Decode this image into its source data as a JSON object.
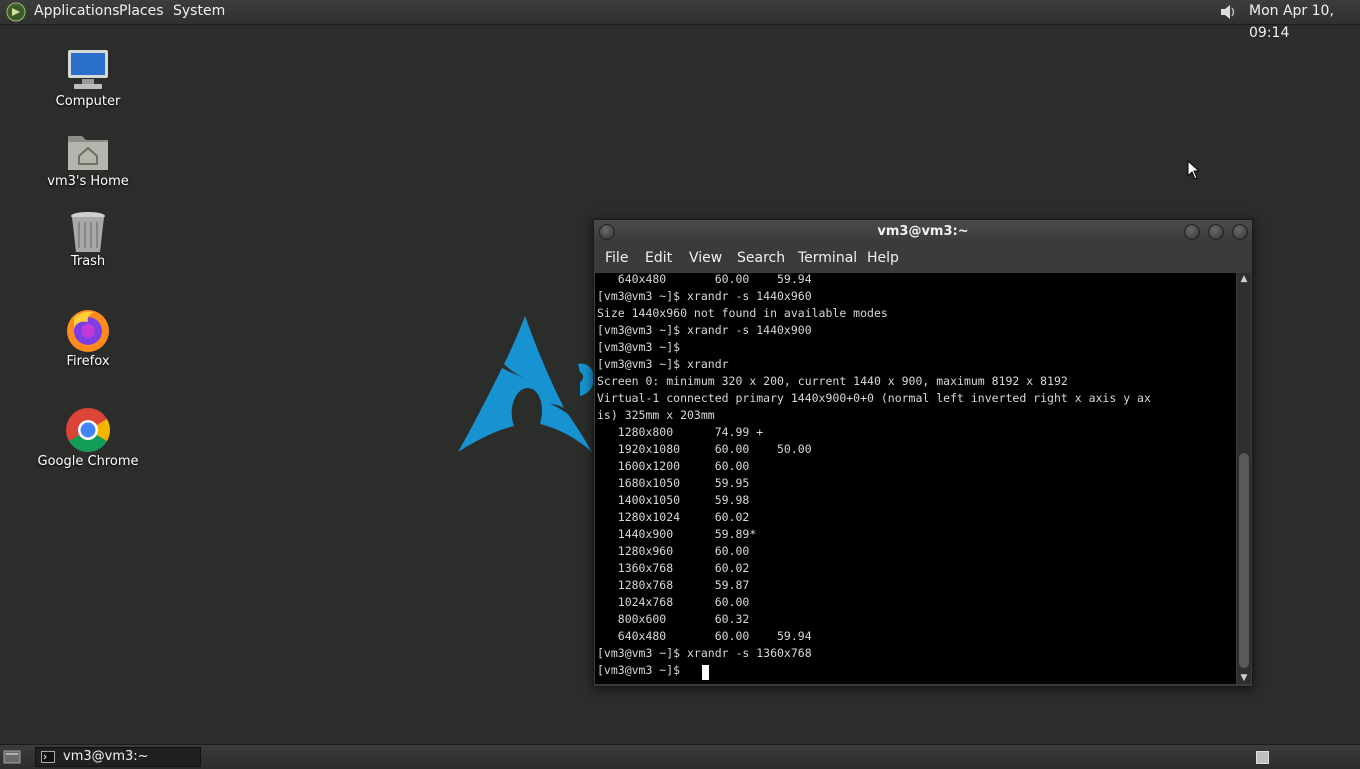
{
  "top_panel": {
    "menus": [
      "Applications",
      "Places",
      "System"
    ],
    "clock": "Mon Apr 10, 09:14",
    "logo_icon": "gnome-foot-icon",
    "tray_icons": [
      "speaker-icon"
    ]
  },
  "desktop": {
    "icons": [
      {
        "label": "Computer",
        "icon": "computer-icon"
      },
      {
        "label": "vm3's Home",
        "icon": "home-folder-icon"
      },
      {
        "label": "Trash",
        "icon": "trash-icon"
      },
      {
        "label": "Firefox",
        "icon": "firefox-icon"
      },
      {
        "label": "Google Chrome",
        "icon": "chrome-icon"
      }
    ],
    "wallpaper_logo": "arch-linux-logo",
    "colors": {
      "background": "#2b2d2b",
      "arch_blue": "#1793d1"
    }
  },
  "terminal": {
    "title": "vm3@vm3:~",
    "menu": [
      "File",
      "Edit",
      "View",
      "Search",
      "Terminal",
      "Help"
    ],
    "lines": [
      "   640x480       60.00    59.94",
      "[vm3@vm3 ~]$ xrandr -s 1440x960",
      "Size 1440x960 not found in available modes",
      "[vm3@vm3 ~]$ xrandr -s 1440x900",
      "[vm3@vm3 ~]$",
      "[vm3@vm3 ~]$ xrandr",
      "Screen 0: minimum 320 x 200, current 1440 x 900, maximum 8192 x 8192",
      "Virtual-1 connected primary 1440x900+0+0 (normal left inverted right x axis y ax",
      "is) 325mm x 203mm",
      "   1280x800      74.99 +",
      "   1920x1080     60.00    50.00",
      "   1600x1200     60.00",
      "   1680x1050     59.95",
      "   1400x1050     59.98",
      "   1280x1024     60.02",
      "   1440x900      59.89*",
      "   1280x960      60.00",
      "   1360x768      60.02",
      "   1280x768      59.87",
      "   1024x768      60.00",
      "   800x600       60.32",
      "   640x480       60.00    59.94",
      "[vm3@vm3 ~]$ xrandr -s 1360x768",
      "[vm3@vm3 ~]$ "
    ],
    "colors": {
      "background": "#000000",
      "foreground": "#d8d8d8"
    }
  },
  "bottom_panel": {
    "task_label": "vm3@vm3:~",
    "task_icon": "terminal-icon",
    "show_desktop_icon": "show-desktop-icon",
    "workspace_icon": "workspace-switcher-icon"
  }
}
